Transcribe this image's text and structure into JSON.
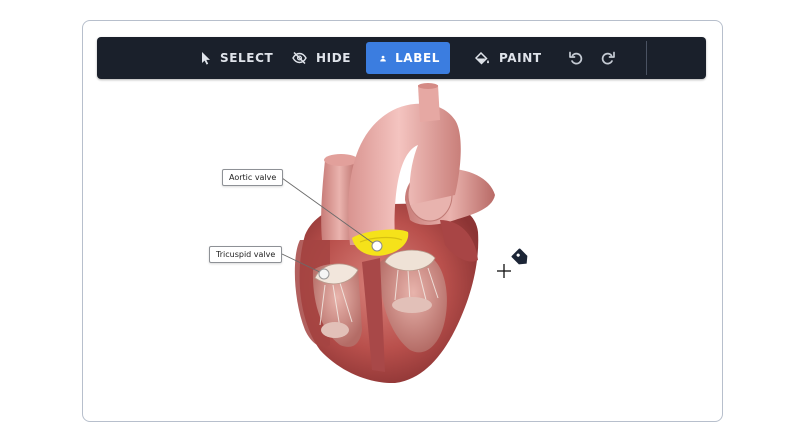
{
  "toolbar": {
    "tools": [
      {
        "label": "SELECT",
        "icon": "cursor-icon",
        "active": false
      },
      {
        "label": "HIDE",
        "icon": "eye-off-icon",
        "active": false
      },
      {
        "label": "LABEL",
        "icon": "person-icon",
        "active": true
      },
      {
        "label": "PAINT",
        "icon": "paint-bucket-icon",
        "active": false
      }
    ],
    "undo_icon": "undo-icon",
    "redo_icon": "redo-icon"
  },
  "labels": {
    "aortic": "Aortic valve",
    "tricuspid": "Tricuspid valve"
  },
  "colors": {
    "toolbar_bg": "#1a202b",
    "active_tool": "#3b7de0",
    "valve_highlight": "#f5e21a"
  }
}
